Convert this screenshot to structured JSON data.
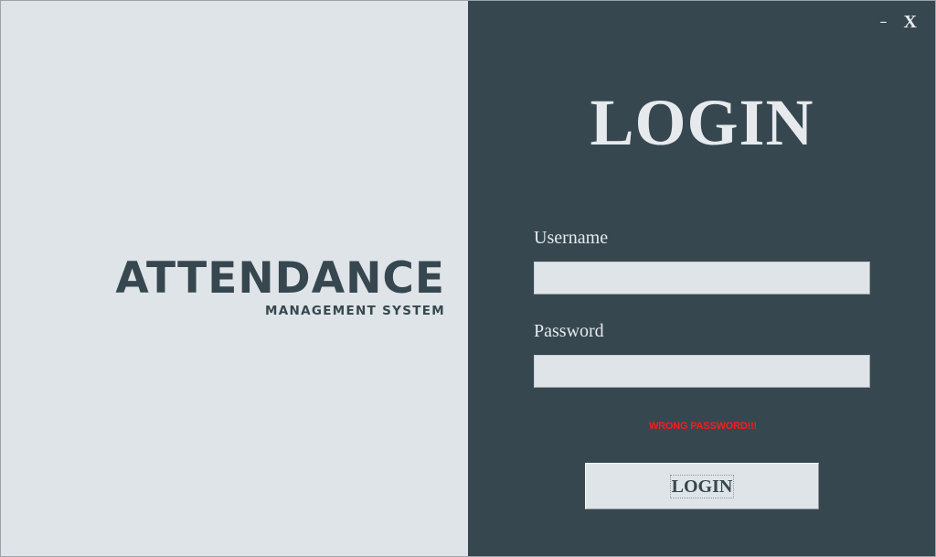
{
  "window": {
    "minimize_label": "–",
    "close_label": "X"
  },
  "brand": {
    "title": "ATTENDANCE",
    "subtitle": "MANAGEMENT SYSTEM"
  },
  "login": {
    "heading": "LOGIN",
    "username_label": "Username",
    "username_value": "",
    "password_label": "Password",
    "password_value": "",
    "error_message": "WRONG PASSWORD!!!",
    "button_label": "LOGIN"
  },
  "colors": {
    "left_panel_bg": "#dfe4e8",
    "right_panel_bg": "#37474f",
    "error": "#ff1a1a",
    "accent_text": "#37474f"
  }
}
